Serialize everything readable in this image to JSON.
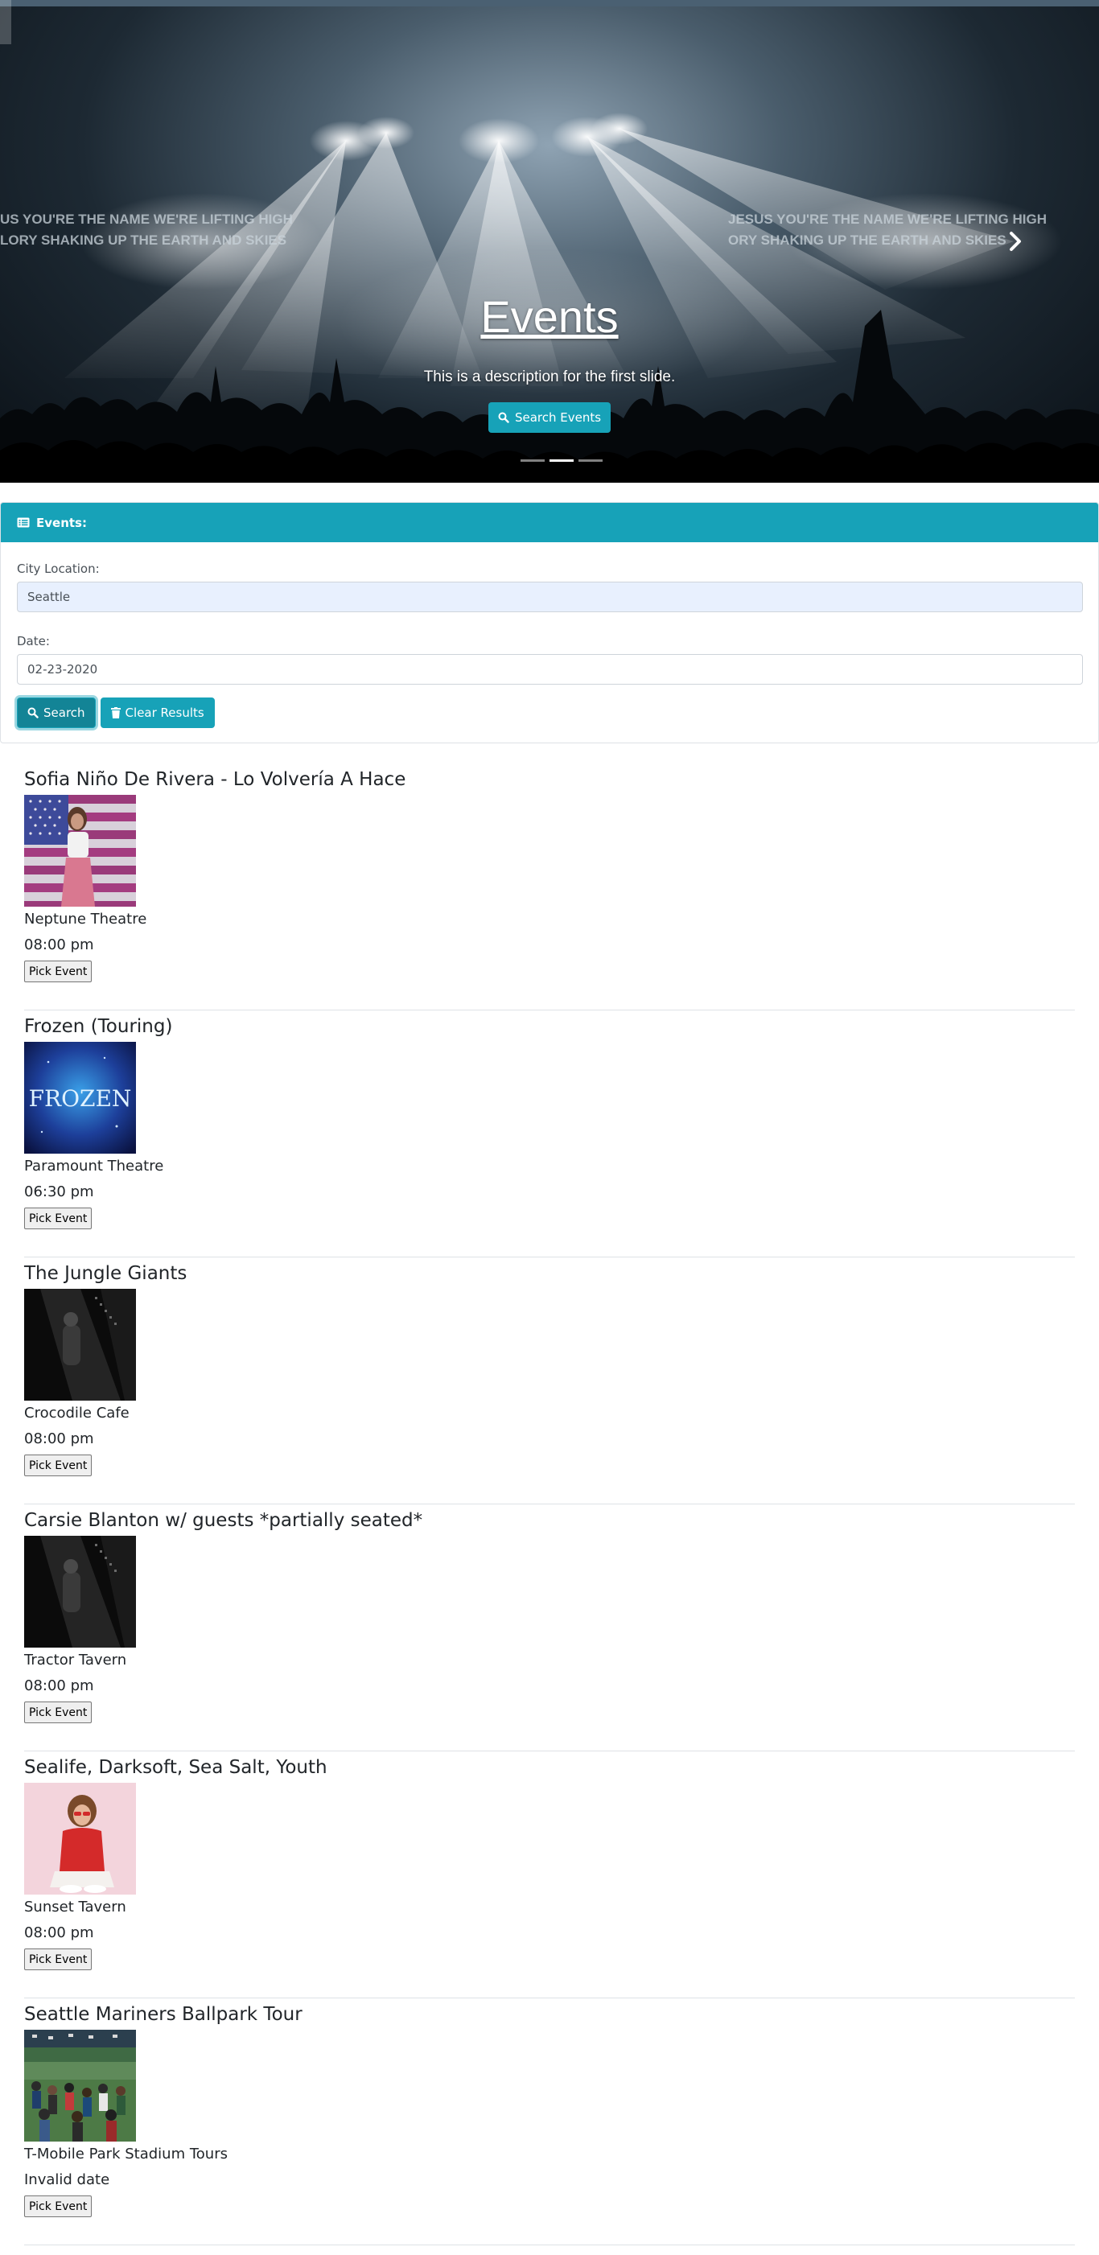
{
  "hero": {
    "title": "Events",
    "description": "This is a description for the first slide.",
    "search_button": "Search Events",
    "banner_text_left": "US YOU'RE THE NAME WE'RE LIFTING HIGH",
    "banner_text_left_2": "LORY SHAKING UP THE EARTH AND SKIES",
    "banner_text_right": "JESUS YOU'RE THE NAME WE'RE LIFTING HIGH",
    "banner_text_right_2": "ORY SHAKING UP THE EARTH AND SKIES",
    "slides_count": 3,
    "active_slide": 1
  },
  "search_card": {
    "header": "Events:",
    "city_label": "City Location:",
    "city_value": "Seattle",
    "date_label": "Date:",
    "date_value": "02-23-2020",
    "search_button": "Search",
    "clear_button": "Clear Results"
  },
  "events": [
    {
      "title": "Sofia Niño De Rivera - Lo Volvería A Hace",
      "venue": "Neptune Theatre",
      "time": "08:00 pm",
      "button": "Pick Event",
      "image": "flag-portrait"
    },
    {
      "title": "Frozen (Touring)",
      "venue": "Paramount Theatre",
      "time": "06:30 pm",
      "button": "Pick Event",
      "image": "frozen-poster",
      "image_text": "FROZEN"
    },
    {
      "title": "The Jungle Giants",
      "venue": "Crocodile Cafe",
      "time": "08:00 pm",
      "button": "Pick Event",
      "image": "dark-stage"
    },
    {
      "title": "Carsie Blanton w/ guests *partially seated*",
      "venue": "Tractor Tavern",
      "time": "08:00 pm",
      "button": "Pick Event",
      "image": "dark-stage"
    },
    {
      "title": "Sealife, Darksoft, Sea Salt, Youth",
      "venue": "Sunset Tavern",
      "time": "08:00 pm",
      "button": "Pick Event",
      "image": "red-hoodie-portrait"
    },
    {
      "title": "Seattle Mariners Ballpark Tour",
      "venue": "T-Mobile Park Stadium Tours",
      "time": "Invalid date",
      "button": "Pick Event",
      "image": "ballpark-crowd"
    }
  ],
  "colors": {
    "accent": "#17a2b8",
    "accent_dark": "#138496",
    "autofill_bg": "#e8f0fe",
    "divider": "#dee2e6"
  }
}
